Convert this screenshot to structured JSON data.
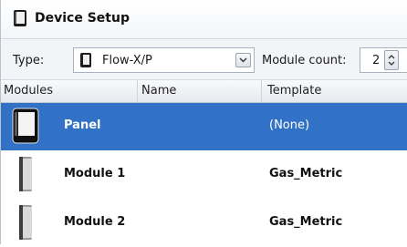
{
  "window": {
    "title": "Device Setup",
    "icon": "device-icon"
  },
  "toolbar": {
    "type_label": "Type:",
    "type_value": "Flow-X/P",
    "module_count_label": "Module count:",
    "module_count_value": "2"
  },
  "table": {
    "columns": [
      "Modules",
      "Name",
      "Template"
    ],
    "rows": [
      {
        "name": "Panel",
        "template": "(None)",
        "selected": true,
        "icon": "panel-device-icon"
      },
      {
        "name": "Module 1",
        "template": "Gas_Metric",
        "selected": false,
        "icon": "module-device-icon"
      },
      {
        "name": "Module 2",
        "template": "Gas_Metric",
        "selected": false,
        "icon": "module-device-icon"
      }
    ]
  },
  "colors": {
    "selection": "#3272c6",
    "toolbar_bg": "#f2f4f7"
  }
}
